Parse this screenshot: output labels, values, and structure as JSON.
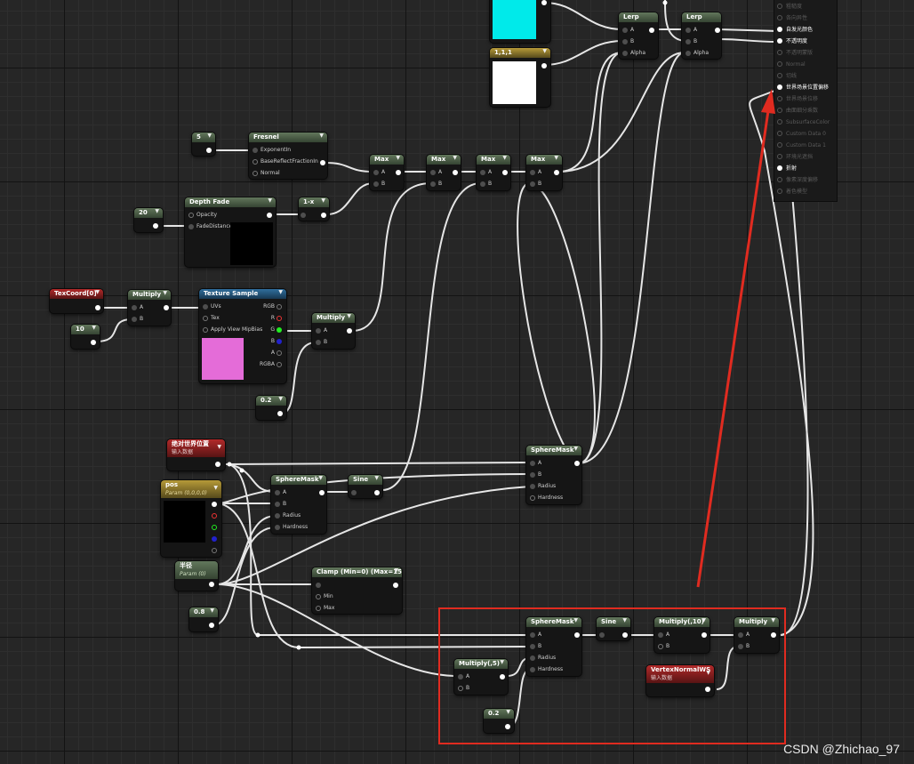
{
  "graph": {
    "nodes": {
      "color_cyan": {
        "output": "",
        "color": "#00eaea"
      },
      "color_white": {
        "title": "1,1,1",
        "color": "#ffffff"
      },
      "lerp1": {
        "title": "Lerp",
        "pins": [
          "A",
          "B",
          "Alpha"
        ]
      },
      "lerp2": {
        "title": "Lerp",
        "pins": [
          "A",
          "B",
          "Alpha"
        ]
      },
      "const5": {
        "value": "5"
      },
      "fresnel": {
        "title": "Fresnel",
        "pins": [
          "ExponentIn",
          "BaseReflectFractionIn",
          "Normal"
        ]
      },
      "const20": {
        "value": "20"
      },
      "depth_fade": {
        "title": "Depth Fade",
        "pins": [
          "Opacity",
          "FadeDistance"
        ]
      },
      "one_minus": {
        "title": "1-x"
      },
      "max1": {
        "title": "Max",
        "pins": [
          "A",
          "B"
        ]
      },
      "max2": {
        "title": "Max",
        "pins": [
          "A",
          "B"
        ]
      },
      "max3": {
        "title": "Max",
        "pins": [
          "A",
          "B"
        ]
      },
      "max4": {
        "title": "Max",
        "pins": [
          "A",
          "B"
        ]
      },
      "texcoord": {
        "title": "TexCoord[0]"
      },
      "multiply1": {
        "title": "Multiply",
        "pins": [
          "A",
          "B"
        ]
      },
      "const10": {
        "value": "10"
      },
      "texture_sample": {
        "title": "Texture Sample",
        "inputs": [
          "UVs",
          "Tex",
          "Apply View MipBias"
        ],
        "outputs": [
          "RGB",
          "R",
          "G",
          "B",
          "A",
          "RGBA"
        ],
        "preview_color": "#e46cd8"
      },
      "multiply2": {
        "title": "Multiply",
        "pins": [
          "A",
          "B"
        ]
      },
      "const02a": {
        "value": "0.2"
      },
      "abs_world_pos": {
        "title": "绝对世界位置",
        "subtitle": "输入数据"
      },
      "pos_param": {
        "title": "pos",
        "subtitle": "Param (0,0,0,0)"
      },
      "radius_param": {
        "title": "半径",
        "subtitle": "Param (0)"
      },
      "const08": {
        "value": "0.8"
      },
      "spheremask1": {
        "title": "SphereMask",
        "pins": [
          "A",
          "B",
          "Radius",
          "Hardness"
        ]
      },
      "sine1": {
        "title": "Sine"
      },
      "clamp": {
        "title": "Clamp (Min=0) (Max=15)",
        "pins": [
          "Min",
          "Max"
        ]
      },
      "spheremask2": {
        "title": "SphereMask",
        "pins": [
          "A",
          "B",
          "Radius",
          "Hardness"
        ]
      },
      "spheremask3": {
        "title": "SphereMask",
        "pins": [
          "A",
          "B",
          "Radius",
          "Hardness"
        ]
      },
      "sine2": {
        "title": "Sine"
      },
      "multiply10": {
        "title": "Multiply(,10)",
        "pins": [
          "A",
          "B"
        ]
      },
      "multiply3": {
        "title": "Multiply",
        "pins": [
          "A",
          "B"
        ]
      },
      "multiply5": {
        "title": "Multiply(,5)",
        "pins": [
          "A",
          "B"
        ]
      },
      "const02b": {
        "value": "0.2"
      },
      "vertex_normal": {
        "title": "VertexNormalWS",
        "subtitle": "输入数据"
      }
    }
  },
  "material_node": {
    "pins": [
      {
        "label": "粗糙度",
        "active": false
      },
      {
        "label": "各向异性",
        "active": false
      },
      {
        "label": "自发光颜色",
        "active": true
      },
      {
        "label": "不透明度",
        "active": true
      },
      {
        "label": "不透明蒙版",
        "active": false
      },
      {
        "label": "Normal",
        "active": false
      },
      {
        "label": "切线",
        "active": false
      },
      {
        "label": "世界场景位置偏移",
        "active": true
      },
      {
        "label": "世界场景位移",
        "active": false
      },
      {
        "label": "曲面细分乘数",
        "active": false
      },
      {
        "label": "SubsurfaceColor",
        "active": false
      },
      {
        "label": "Custom Data 0",
        "active": false
      },
      {
        "label": "Custom Data 1",
        "active": false
      },
      {
        "label": "环境光遮挡",
        "active": false
      },
      {
        "label": "折射",
        "active": true
      },
      {
        "label": "像素深度偏移",
        "active": false
      },
      {
        "label": "着色模型",
        "active": false
      }
    ]
  },
  "annotation": {
    "box_color": "#e02b20",
    "arrow_color": "#e02b20"
  },
  "watermark": "CSDN @Zhichao_97"
}
